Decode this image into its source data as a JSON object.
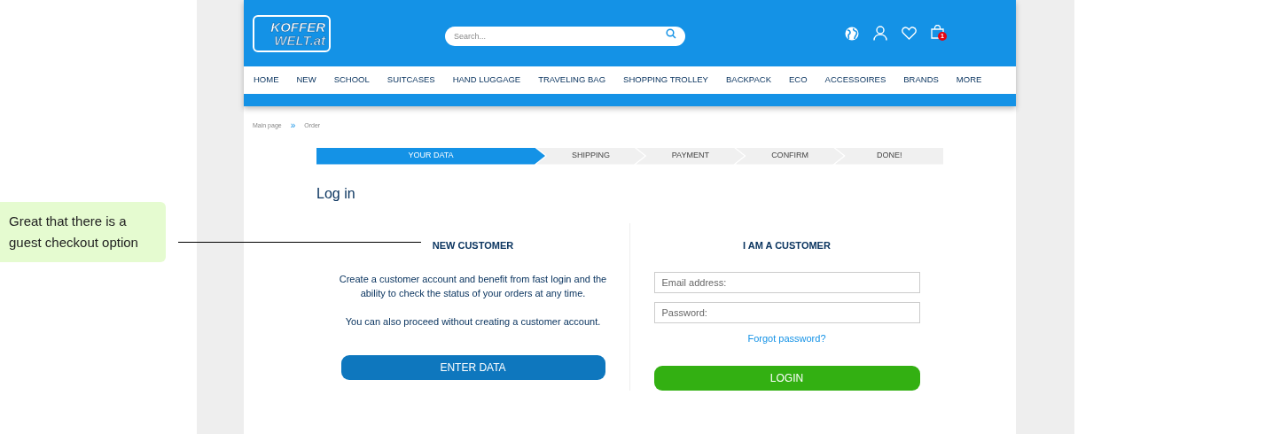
{
  "annotation": {
    "text": "Great that there is a guest checkout option"
  },
  "header": {
    "logo": {
      "line_1": "KOFFER",
      "line_2": "WELT.at"
    },
    "search": {
      "placeholder": "Search..."
    },
    "cart_count": "1"
  },
  "nav": [
    "HOME",
    "NEW",
    "SCHOOL",
    "SUITCASES",
    "HAND LUGGAGE",
    "TRAVELING BAG",
    "SHOPPING TROLLEY",
    "BACKPACK",
    "ECO",
    "ACCESSOIRES",
    "BRANDS",
    "MORE"
  ],
  "breadcrumb": [
    "Main page",
    "Order"
  ],
  "breadcrumb_separator": "»",
  "steps": [
    {
      "label": "YOUR DATA",
      "selected": true
    },
    {
      "label": "SHIPPING",
      "selected": false
    },
    {
      "label": "PAYMENT",
      "selected": false
    },
    {
      "label": "CONFIRM",
      "selected": false
    },
    {
      "label": "DONE!",
      "selected": false
    }
  ],
  "title": "Log in",
  "new_customer": {
    "heading": "NEW CUSTOMER",
    "paragraphs": [
      "Create a customer account and benefit from fast login and the ability to check the status of your orders at any time.",
      "You can also proceed without creating a customer account."
    ],
    "button": "ENTER DATA"
  },
  "existing_customer": {
    "heading": "I AM A CUSTOMER",
    "email": {
      "placeholder": "Email address:"
    },
    "password": {
      "placeholder": "Password:"
    },
    "forgot_link": "Forgot password?",
    "button": "LOGIN"
  }
}
